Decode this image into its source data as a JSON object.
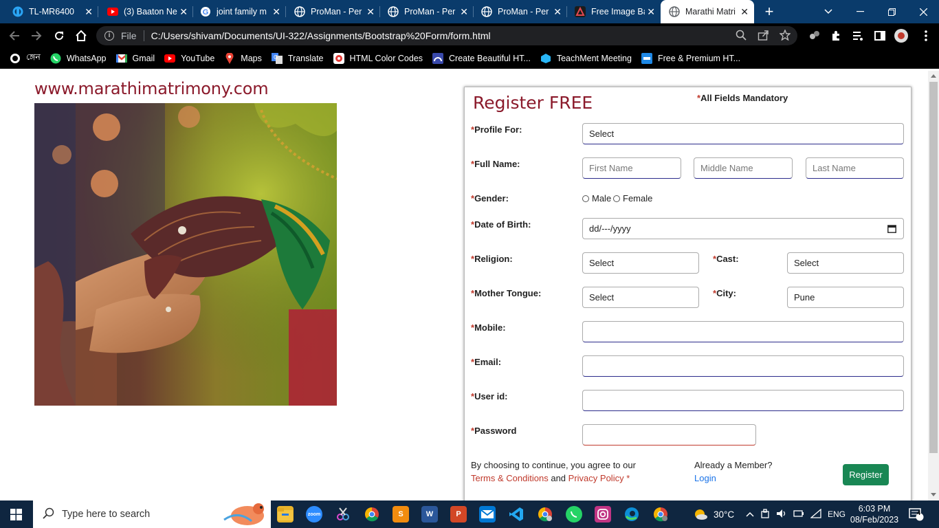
{
  "browser": {
    "tabs": [
      {
        "title": "TL-MR6400",
        "icon": "tplink-icon",
        "color": "#2aa4f4"
      },
      {
        "title": "(3) Baaton Ne",
        "icon": "youtube-icon",
        "color": "#ff0000"
      },
      {
        "title": "joint family m",
        "icon": "google-icon",
        "color": "#4285f4"
      },
      {
        "title": "ProMan - Per",
        "icon": "globe-icon",
        "color": "#ffffff"
      },
      {
        "title": "ProMan - Per",
        "icon": "globe-icon",
        "color": "#ffffff"
      },
      {
        "title": "ProMan - Per",
        "icon": "globe-icon",
        "color": "#ffffff"
      },
      {
        "title": "Free Image Ba",
        "icon": "adobe-icon",
        "color": "#e34850"
      },
      {
        "title": "Marathi Matri",
        "icon": "globe-icon",
        "color": "#5f6368"
      }
    ],
    "address": {
      "scheme_label": "File",
      "url": "C:/Users/shivam/Documents/UI-322/Assignments/Bootstrap%20Form/form.html"
    },
    "bookmarks": [
      {
        "label": "ঙ্গেন",
        "icon": "github-icon"
      },
      {
        "label": "WhatsApp",
        "icon": "whatsapp-icon"
      },
      {
        "label": "Gmail",
        "icon": "gmail-icon"
      },
      {
        "label": "YouTube",
        "icon": "youtube-icon"
      },
      {
        "label": "Maps",
        "icon": "maps-icon"
      },
      {
        "label": "Translate",
        "icon": "translate-icon"
      },
      {
        "label": "HTML Color Codes",
        "icon": "html-color-icon"
      },
      {
        "label": "Create Beautiful HT...",
        "icon": "create-html-icon"
      },
      {
        "label": "TeachMent Meeting",
        "icon": "teachment-icon"
      },
      {
        "label": "Free & Premium HT...",
        "icon": "premium-html-icon"
      }
    ]
  },
  "page": {
    "site_title": "www.marathimatrimony.com",
    "form": {
      "title": "Register FREE",
      "mandatory_star": "*",
      "mandatory_note": "All Fields Mandatory",
      "required_star": "*",
      "labels": {
        "profile_for": "Profile For:",
        "full_name": "Full Name:",
        "gender": "Gender:",
        "dob": "Date of Birth:",
        "religion": "Religion:",
        "cast": "Cast:",
        "mother_tongue": "Mother Tongue:",
        "city": "City:",
        "mobile": "Mobile:",
        "email": "Email:",
        "user_id": "User id:",
        "password": "Password"
      },
      "values": {
        "profile_for": "Select",
        "religion": "Select",
        "cast": "Select",
        "mother_tongue": "Select",
        "city": "Pune",
        "mobile": "",
        "email": "",
        "user_id": "",
        "password": ""
      },
      "placeholders": {
        "first_name": "First Name",
        "middle_name": "Middle Name",
        "last_name": "Last Name",
        "dob": "dd/---/yyyy"
      },
      "gender_options": [
        "Male",
        "Female"
      ],
      "terms_line1": "By choosing to continue, you agree to our",
      "terms_link": "Terms & Conditions",
      "and_text": "and",
      "privacy_link": "Privacy Policy *",
      "member_question": "Already a Member?",
      "login_link": "Login",
      "register_button": "Register",
      "accent_color": "#8b1a2b",
      "button_color": "#198754"
    }
  },
  "taskbar": {
    "search_placeholder": "Type here to search",
    "weather": "30°C",
    "language": "ENG",
    "time": "6:03 PM",
    "date": "08/Feb/2023",
    "notification_count": "4"
  }
}
